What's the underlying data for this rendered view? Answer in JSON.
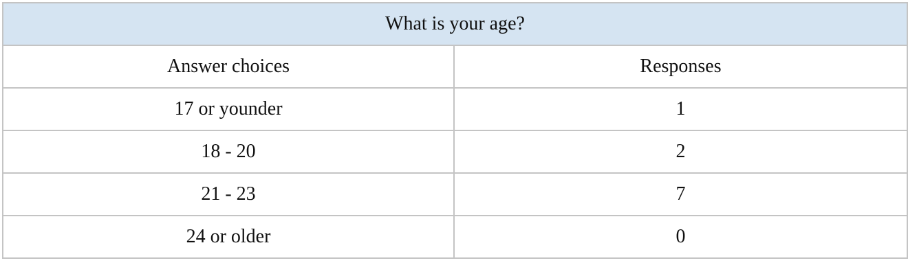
{
  "table": {
    "question": "What is your age?",
    "headers": [
      "Answer choices",
      "Responses"
    ],
    "rows": [
      {
        "choice": "17 or younder",
        "responses": "1"
      },
      {
        "choice": "18 - 20",
        "responses": "2"
      },
      {
        "choice": "21 - 23",
        "responses": "7"
      },
      {
        "choice": "24 or older",
        "responses": "0"
      }
    ],
    "header_color": "#d5e4f2",
    "border_color": "#c4c4c4"
  }
}
